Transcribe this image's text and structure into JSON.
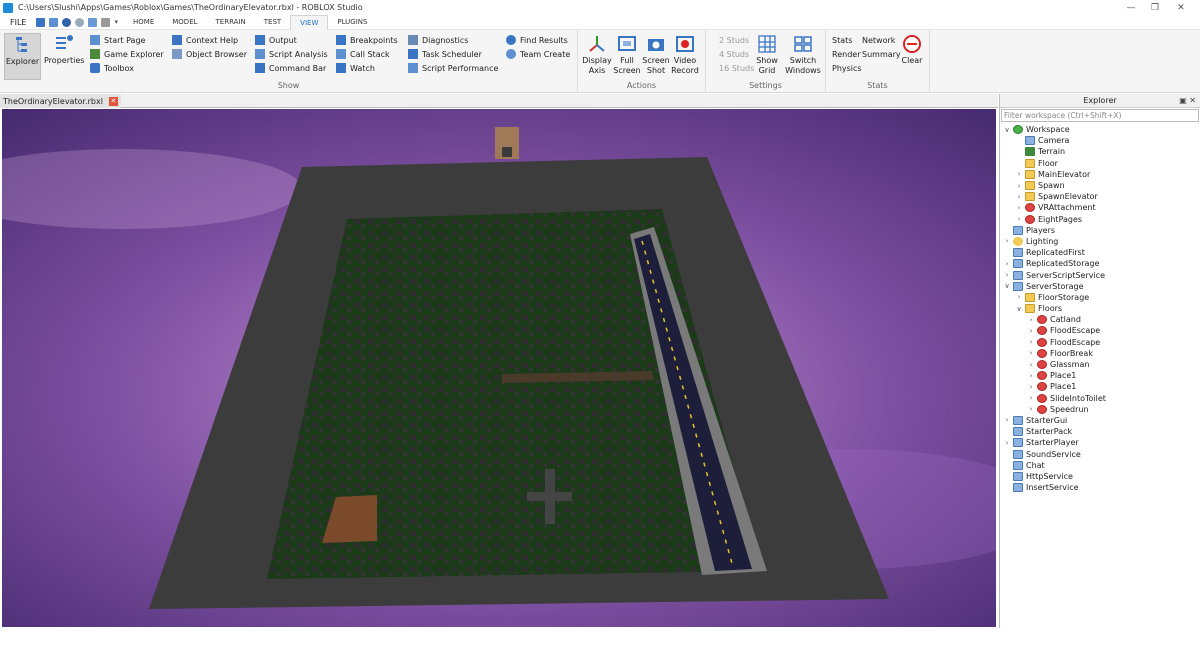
{
  "window": {
    "title": "C:\\Users\\Slushi\\Apps\\Games\\Roblox\\Games\\TheOrdinaryElevator.rbxl - ROBLOX Studio"
  },
  "menu": {
    "file": "FILE",
    "tabs": [
      "HOME",
      "MODEL",
      "TERRAIN",
      "TEST",
      "VIEW",
      "PLUGINS"
    ]
  },
  "ribbon": {
    "show": {
      "label": "Show",
      "explorer": "Explorer",
      "properties": "Properties",
      "items": [
        "Start Page",
        "Game Explorer",
        "Toolbox",
        "Context Help",
        "Object Browser",
        "Output",
        "Script Analysis",
        "Command Bar",
        "Breakpoints",
        "Call Stack",
        "Watch",
        "Diagnostics",
        "Task Scheduler",
        "Script Performance",
        "Find Results",
        "Team Create"
      ]
    },
    "actions": {
      "label": "Actions",
      "display_axis": "Display Axis",
      "full_screen": "Full Screen",
      "screen_shot": "Screen Shot",
      "video_record": "Video Record"
    },
    "settings": {
      "label": "Settings",
      "studs": [
        "2 Studs",
        "4 Studs",
        "16 Studs"
      ],
      "show_grid": "Show Grid",
      "switch_windows": "Switch Windows"
    },
    "stats": {
      "label": "Stats",
      "items": [
        "Stats",
        "Render",
        "Physics",
        "Network",
        "Summary"
      ],
      "clear": "Clear"
    }
  },
  "document": {
    "tab": "TheOrdinaryElevator.rbxl"
  },
  "explorer": {
    "title": "Explorer",
    "filter_placeholder": "Filter workspace (Ctrl+Shift+X)",
    "tree": [
      "Workspace",
      "Camera",
      "Terrain",
      "Floor",
      "MainElevator",
      "Spawn",
      "SpawnElevator",
      "VRAttachment",
      "EightPages",
      "Players",
      "Lighting",
      "ReplicatedFirst",
      "ReplicatedStorage",
      "ServerScriptService",
      "ServerStorage",
      "FloorStorage",
      "Floors",
      "Catland",
      "FloodEscape",
      "FloodEscape",
      "FloorBreak",
      "Glassman",
      "Place1",
      "Place1",
      "SlideIntoToilet",
      "Speedrun",
      "StarterGui",
      "StarterPack",
      "StarterPlayer",
      "SoundService",
      "Chat",
      "HttpService",
      "InsertService"
    ]
  }
}
